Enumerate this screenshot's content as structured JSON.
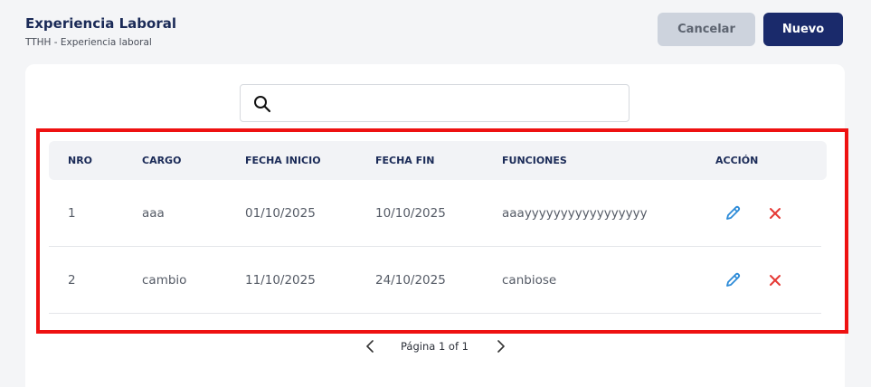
{
  "header": {
    "title": "Experiencia Laboral",
    "breadcrumb": "TTHH  - Experiencia laboral"
  },
  "actions": {
    "cancel_label": "Cancelar",
    "new_label": "Nuevo"
  },
  "search": {
    "icon": "search-icon",
    "value": "",
    "placeholder": ""
  },
  "table": {
    "columns": [
      "NRO",
      "CARGO",
      "FECHA INICIO",
      "FECHA FIN",
      "FUNCIONES",
      "ACCIÓN"
    ],
    "rows": [
      {
        "nro": "1",
        "cargo": "aaa",
        "fecha_inicio": "01/10/2025",
        "fecha_fin": "10/10/2025",
        "funciones": "aaayyyyyyyyyyyyyyyyy"
      },
      {
        "nro": "2",
        "cargo": "cambio",
        "fecha_inicio": "11/10/2025",
        "fecha_fin": "24/10/2025",
        "funciones": "canbiose"
      }
    ],
    "row_actions": [
      "edit-icon",
      "delete-icon"
    ]
  },
  "pagination": {
    "label": "Página 1 of 1"
  },
  "colors": {
    "primary": "#1a2a6b",
    "cancel_bg": "#cdd3dd",
    "edit_icon": "#2c8bd8",
    "delete_icon": "#e53935",
    "highlight_border": "#ee1111"
  }
}
